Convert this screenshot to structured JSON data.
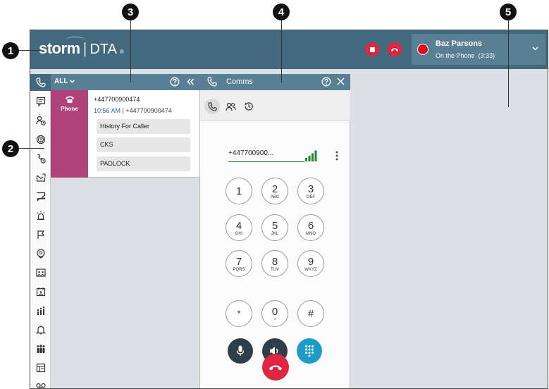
{
  "callouts": [
    "1",
    "2",
    "3",
    "4",
    "5"
  ],
  "header": {
    "logo_brand": "storm",
    "logo_product": "DTA",
    "logo_reg": "®",
    "user_name": "Baz Parsons",
    "status_text": "On the Phone",
    "status_timer": "(3:33)",
    "colors": {
      "bar": "#42697e",
      "hangup": "#e0263f",
      "status_dot": "#d4121f"
    }
  },
  "sidebar": {
    "items": [
      "phone-icon",
      "message-icon",
      "contact-schedule-icon",
      "alert-circle-icon",
      "callback-icon",
      "email-icon",
      "note-icon",
      "alarm-icon",
      "flag-icon",
      "location-icon",
      "gallery-icon",
      "calendar-icon",
      "team-stats-icon",
      "bell-icon",
      "people-icon",
      "forms-icon",
      "voicemail-icon"
    ]
  },
  "list_panel": {
    "filter_label": "ALL",
    "card": {
      "channel": "Phone",
      "number": "+447700900474",
      "time": "10:56 AM",
      "separator": "|",
      "caller": "+447700900474",
      "actions": [
        "History For Caller",
        "CKS",
        "PADLOCK"
      ],
      "strip_color": "#b0437a"
    }
  },
  "comms_panel": {
    "title": "Comms",
    "dial_number": "+447700900...",
    "keys": [
      {
        "digit": "1",
        "letters": ""
      },
      {
        "digit": "2",
        "letters": "ABC"
      },
      {
        "digit": "3",
        "letters": "DEF"
      },
      {
        "digit": "4",
        "letters": "GHI"
      },
      {
        "digit": "5",
        "letters": "JKL"
      },
      {
        "digit": "6",
        "letters": "MNO"
      },
      {
        "digit": "7",
        "letters": "PQRS"
      },
      {
        "digit": "8",
        "letters": "TUV"
      },
      {
        "digit": "9",
        "letters": "WXYZ"
      },
      {
        "digit": "*",
        "letters": ""
      },
      {
        "digit": "0",
        "letters": "+"
      },
      {
        "digit": "#",
        "letters": ""
      }
    ],
    "controls": [
      "microphone-icon",
      "speaker-icon",
      "keypad-icon"
    ],
    "colors": {
      "control_dark": "#2f3f4a",
      "keypad_active": "#1e9cc7",
      "signal": "#1e8a2c"
    }
  }
}
